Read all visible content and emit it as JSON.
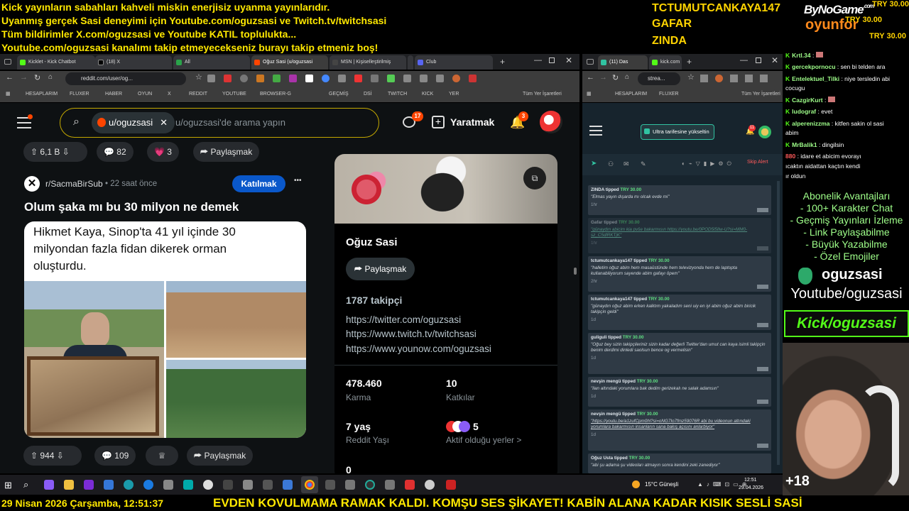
{
  "overlay": {
    "lines": [
      "Kick yayınların sabahları kahveli miskin enerjisiz uyanma yayınlarıdır.",
      "Uyanmış gerçek Sasi deneyimi için Youtube.com/oguzsasi ve Twitch.tv/twitchsasi",
      "Tüm bildirimler X.com/oguzsasi ve Youtube KATIL toplulukta...",
      "Youtube.com/oguzsasi kanalımı takip etmeyecekseniz burayı takip etmeniz boş!"
    ],
    "donors": [
      "TCTUMUTCANKAYA147",
      "GAFAR",
      "ZINDA"
    ],
    "logo_top": "ByNoGame",
    "logo_small": ".com",
    "logo_bottom": "oyunfor",
    "amounts": [
      "TRY 30.00",
      "TRY 30.00",
      "TRY 30.00"
    ],
    "plus_count": "+18",
    "bottom_date": "29 Nisan 2026 Çarşamba, 12:51:37",
    "bottom_ticker": "EVDEN KOVULMAMA RAMAK KALDI. KOMŞU SES ŞİKAYET! KABİN ALANA KADAR KISIK SESLİ SASİ"
  },
  "browser_left": {
    "tabs": [
      "Kicklet - Kick Chatbot",
      "(18) X",
      "All",
      "Oğuz Sasi (u/oguzsasi",
      "MSN | Kişiselleştirilmiş",
      "",
      "Club"
    ],
    "url": "reddit.com/user/og...",
    "bookmarks": [
      "HESAPLARIM",
      "FLUXER",
      "HABER",
      "OYUN",
      "X",
      "REDDIT",
      "YOUTUBE",
      "BROWSER-G",
      "GEÇMİŞ",
      "DSİ",
      "TWITCH",
      "KICK",
      "YER",
      "Tüm Yer İşaretleri"
    ]
  },
  "reddit": {
    "search_chip": "u/oguzsasi",
    "search_placeholder": "u/oguzsasi'de arama yapın",
    "notif_count_chat": "17",
    "create_label": "Yaratmak",
    "notif_count_bell": "3",
    "prev_post": {
      "votes": "6,1 B",
      "comments": "82",
      "awards": "3",
      "share": "Paylaşmak"
    },
    "post": {
      "subreddit": "r/SacmaBirSub",
      "time": "22 saat önce",
      "join": "Katılmak",
      "more": "•••",
      "title": "Olum şaka mı bu 30 milyon ne demek",
      "image_text": "Hikmet Kaya, Sinop'ta 41 yıl içinde 30 milyondan fazla fidan dikerek orman oluşturdu.",
      "votes": "944",
      "comments": "109",
      "share": "Paylaşmak"
    },
    "profile": {
      "name": "Oğuz Sasi",
      "share": "Paylaşmak",
      "followers": "1787 takipçi",
      "links": [
        "https://twitter.com/oguzsasi",
        "https://www.twitch.tv/twitchsasi",
        "https://www.younow.com/oguzsasi"
      ],
      "karma_value": "478.460",
      "karma_label": "Karma",
      "contrib_value": "10",
      "contrib_label": "Katkılar",
      "age_value": "7 yaş",
      "age_label": "Reddit Yaşı",
      "active_value": "5",
      "active_label": "Aktif olduğu yerler >",
      "extra_value": "0"
    }
  },
  "browser_right": {
    "tabs": [
      "(11) Das",
      "kick.com"
    ],
    "url": "strea...",
    "bookmarks": [
      "HESAPLARIM",
      "FLUXER",
      "Tüm Yer İşaretleri"
    ],
    "upgrade": "Ultra tarifesine yükseltin",
    "badge": "11",
    "skip": "Skip Alert",
    "alerts": [
      {
        "name": "ZINDA tipped",
        "amount": "TRY 30.00",
        "msg": "\"Elmas yayın dışarda mı olcak evde mi\"",
        "time": "1hr"
      },
      {
        "name": "Gafar tipped",
        "amount": "TRY 30.00",
        "msg": "\"günaydın abicim kia pvše bakarmısın https://youtu.be/0POD5l5lIw-U?si=MM0-sz_C5dlRKTjK\"",
        "time": "1hr"
      },
      {
        "name": "tctumutcankaya147 tipped",
        "amount": "TRY 30.00",
        "msg": "\"halletim oğuz abim hem masaüstünde hem televizyonda hem de laptopta kullanabiliyorum sayende abim gafayı öpem\"",
        "time": "2hr"
      },
      {
        "name": "tctumutcankaya147 tipped",
        "amount": "TRY 30.00",
        "msg": "\"günaydın oğuz abim erken kalktım yakaladım seni uiy en iyi abim oğuz abim biricik takipçin geldi\"",
        "time": "1d"
      },
      {
        "name": "guliguli tipped",
        "amount": "TRY 30.00",
        "msg": "\"Oğuz bey sizin takipçileriniz sizin kadar değerli Twitter'dan umut can kaya isimli takipçin benim derdimi dinledi saolsun bence og vermelisin\"",
        "time": "1d"
      },
      {
        "name": "nevşin mengü tipped",
        "amount": "TRY 30.00",
        "msg": "\"ilan altındaki yorumlara bak dedim gerizekalı ne salak adamsın\"",
        "time": "1d"
      },
      {
        "name": "nevşin mengü tipped",
        "amount": "TRY 30.00",
        "msg": "\"https://youtu.be/a1zufCpm0hl?si=oNG7Io7fmz59076R abi bu videonun altındaki yorumlara bakarmısın insanların sana bakış açısını anlarbiyor\"",
        "time": "1d"
      },
      {
        "name": "Oğuz Usta tipped",
        "amount": "TRY 30.00",
        "msg": "\"abi şu adama şu videoları atmayın sonra kendini zeki zanediyor\"",
        "time": ""
      }
    ]
  },
  "chat": {
    "messages": [
      {
        "user": "Krtl.34",
        "text": ":"
      },
      {
        "user": "gercekpornocu",
        "text": ": sen bi telden ara"
      },
      {
        "user": "Entelektuel_Tilki",
        "text": ": niye tersledin abi"
      },
      {
        "user": "",
        "text": "cocugu"
      },
      {
        "user": "CazgirKurt",
        "text": ":"
      },
      {
        "user": "ludograf",
        "text": ": evet"
      },
      {
        "user": "alperenizzma",
        "text": ": kitfen sakin ol sasi"
      },
      {
        "user": "",
        "text": "abim"
      },
      {
        "user": "MrBalik1",
        "text": ": dingilsin"
      },
      {
        "user": "880",
        "text": ": idare et abicim evorayı"
      },
      {
        "user": "",
        "text": "ıcaktın aidattan kaçtın kendi"
      },
      {
        "user": "",
        "text": "ır oldun"
      }
    ],
    "benefits_title": "Abonelik Avantajları",
    "benefits": [
      "- 100+ Karakter Chat",
      "- Geçmiş Yayınları İzleme",
      "- Link Paylaşabilme",
      "- Büyük Yazabilme",
      "- Özel Emojiler"
    ],
    "kick_name": "oguzsasi",
    "youtube": "Youtube/oguzsasi",
    "kick_slogan": "Kick/oguzsasi"
  },
  "taskbar": {
    "weather": "15°C Güneşli",
    "time": "12:51",
    "date": "29.04.2026"
  }
}
